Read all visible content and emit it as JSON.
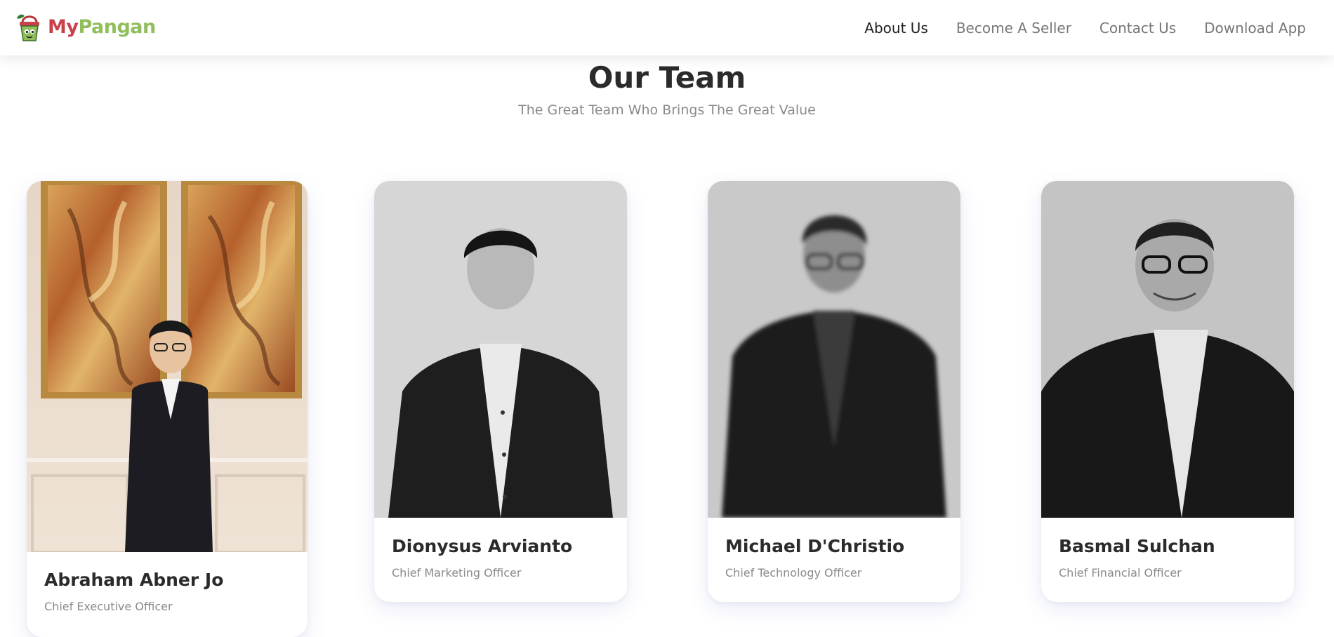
{
  "header": {
    "brand": {
      "part1": "My",
      "part2": "Pangan",
      "color_my": "#c8414b",
      "color_pangan": "#8fbe5b"
    },
    "nav": [
      {
        "label": "About Us",
        "active": true
      },
      {
        "label": "Become A Seller",
        "active": false
      },
      {
        "label": "Contact Us",
        "active": false
      },
      {
        "label": "Download App",
        "active": false
      }
    ]
  },
  "section": {
    "title": "Our Team",
    "subtitle": "The Great Team Who Brings The Great Value"
  },
  "team": [
    {
      "name": "Abraham Abner Jo",
      "role": "Chief Executive Officer",
      "photo": "color-portrait-with-paintings"
    },
    {
      "name": "Dionysus Arvianto",
      "role": "Chief Marketing Officer",
      "photo": "grayscale-portrait"
    },
    {
      "name": "Michael D'Christio",
      "role": "Chief Technology Officer",
      "photo": "grayscale-portrait-blurred"
    },
    {
      "name": "Basmal Sulchan",
      "role": "Chief Financial Officer",
      "photo": "grayscale-portrait"
    }
  ]
}
